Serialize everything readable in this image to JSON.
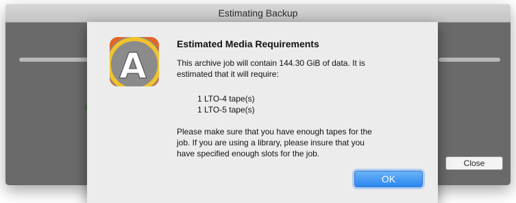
{
  "background_window": {
    "title": "Estimating Backup",
    "close_label": "Close"
  },
  "dialog": {
    "icon_letter": "A",
    "title": "Estimated Media Requirements",
    "message_line1": "This archive job will contain 144.30 GiB of data.  It is",
    "message_line2": "estimated that it will require:",
    "tapes": [
      "1 LTO-4 tape(s)",
      "1 LTO-5 tape(s)"
    ],
    "advice_line1": "Please make sure that you have enough tapes for the",
    "advice_line2": "job.  If you are using a library, please insure that you",
    "advice_line3": "have specified enough slots for the job.",
    "ok_label": "OK"
  },
  "colors": {
    "accent": "#2a86ee",
    "icon_orange": "#e0672a",
    "icon_yellow": "#f2c22c",
    "icon_gray": "#8b8b8b"
  }
}
